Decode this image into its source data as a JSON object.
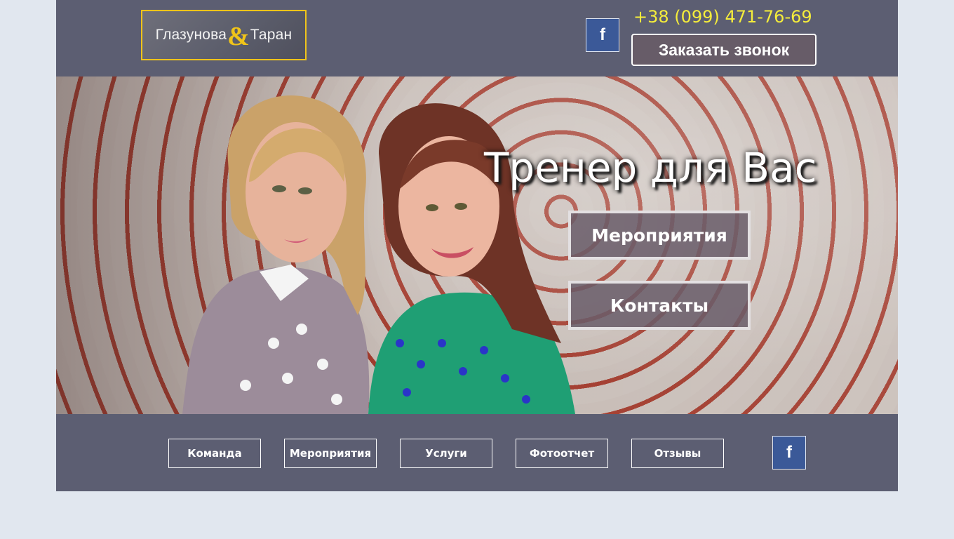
{
  "header": {
    "logo": {
      "left": "Глазунова",
      "amp": "&",
      "right": "Таран"
    },
    "facebook_label": "f",
    "phone": "+38 (099) 471-76-69",
    "callback_label": "Заказать звонок"
  },
  "hero": {
    "title": "Тренер для Вас",
    "buttons": [
      {
        "label": "Мероприятия"
      },
      {
        "label": "Контакты"
      }
    ]
  },
  "nav": {
    "items": [
      {
        "label": "Команда"
      },
      {
        "label": "Мероприятия"
      },
      {
        "label": "Услуги"
      },
      {
        "label": "Фотоотчет"
      },
      {
        "label": "Отзывы"
      }
    ],
    "facebook_label": "f"
  },
  "colors": {
    "page_background": "#e1e7ef",
    "panel": "#5c5e72",
    "logo_accent": "#f0c419",
    "phone": "#f5ed3b",
    "facebook": "#3b5998",
    "button_fill": "#675c68"
  }
}
